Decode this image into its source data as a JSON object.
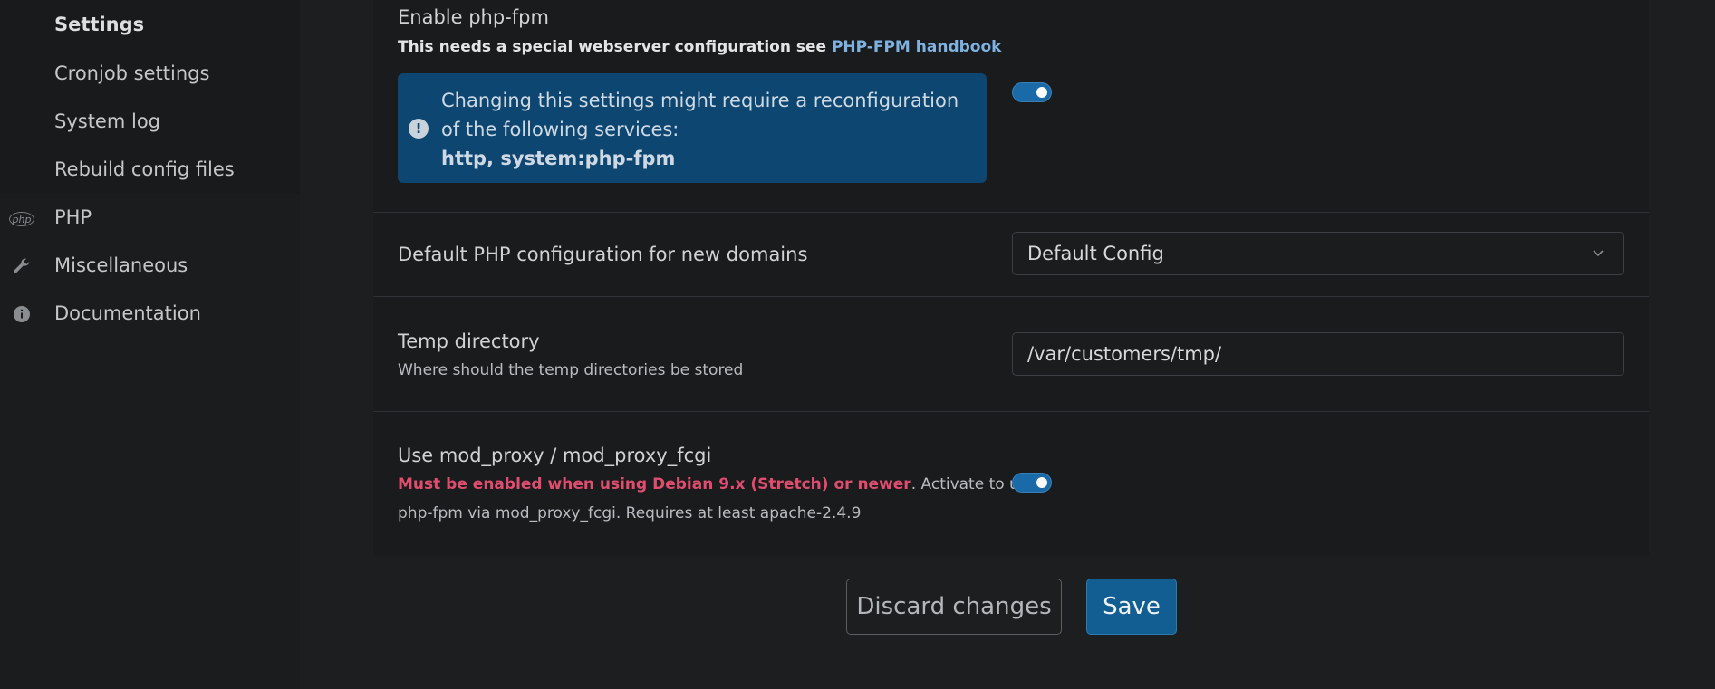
{
  "sidebar": {
    "sub_items": [
      {
        "label": "Settings",
        "active": true
      },
      {
        "label": "Cronjob settings"
      },
      {
        "label": "System log"
      },
      {
        "label": "Rebuild config files"
      }
    ],
    "items": [
      {
        "label": "PHP",
        "icon": "php-icon",
        "icon_text": "php"
      },
      {
        "label": "Miscellaneous",
        "icon": "wrench-icon"
      },
      {
        "label": "Documentation",
        "icon": "info-icon"
      }
    ]
  },
  "settings": {
    "phpfpm": {
      "label": "Enable php-fpm",
      "desc_prefix": "This needs a special webserver configuration see ",
      "desc_link": "PHP-FPM handbook",
      "alert_text": "Changing this settings might require a reconfiguration of the following services:",
      "alert_services": "http, system:php-fpm",
      "enabled": true
    },
    "default_php": {
      "label": "Default PHP configuration for new domains",
      "value": "Default Config"
    },
    "temp_dir": {
      "label": "Temp directory",
      "desc": "Where should the temp directories be stored",
      "value": "/var/customers/tmp/"
    },
    "mod_proxy": {
      "label": "Use mod_proxy / mod_proxy_fcgi",
      "desc_warning": "Must be enabled when using Debian 9.x (Stretch) or newer",
      "desc_line1_rest": ". Activate to use",
      "desc_line2": "php-fpm via mod_proxy_fcgi. Requires at least apache-2.4.9",
      "enabled": true
    }
  },
  "actions": {
    "discard_label": "Discard changes",
    "save_label": "Save"
  },
  "colors": {
    "accent": "#125e92",
    "alert_bg": "#0d4670",
    "danger": "#e04d6f",
    "link": "#7fb2e0"
  }
}
